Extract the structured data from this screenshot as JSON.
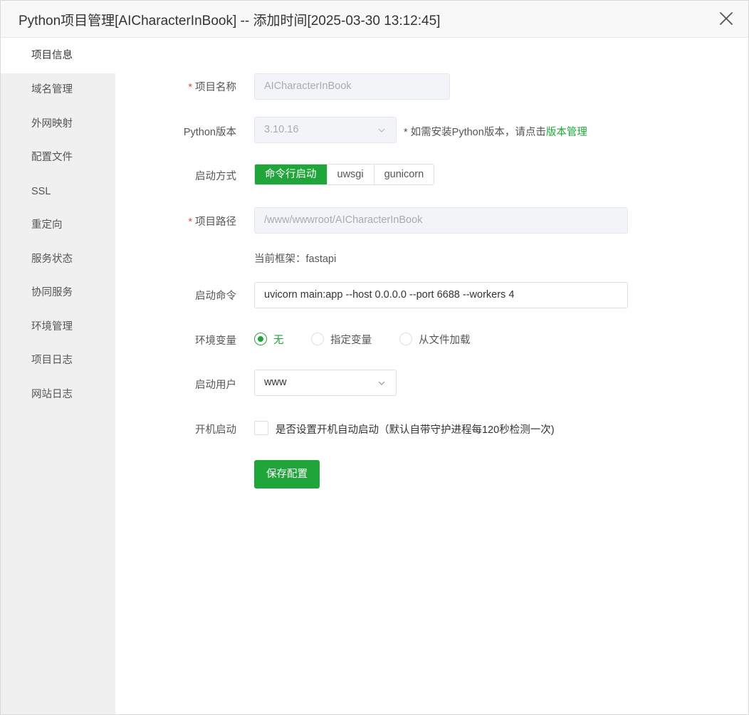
{
  "dialog": {
    "title": "Python项目管理[AICharacterInBook] -- 添加时间[2025-03-30 13:12:45]",
    "close_icon": "close-icon"
  },
  "sidebar": {
    "items": [
      {
        "label": "项目信息",
        "active": true
      },
      {
        "label": "域名管理"
      },
      {
        "label": "外网映射"
      },
      {
        "label": "配置文件"
      },
      {
        "label": "SSL"
      },
      {
        "label": "重定向"
      },
      {
        "label": "服务状态"
      },
      {
        "label": "协同服务"
      },
      {
        "label": "环境管理"
      },
      {
        "label": "项目日志"
      },
      {
        "label": "网站日志"
      }
    ]
  },
  "form": {
    "required_mark": "*",
    "project_name": {
      "label": "项目名称",
      "value": "AICharacterInBook"
    },
    "python_version": {
      "label": "Python版本",
      "value": "3.10.16",
      "hint_prefix": "* 如需安装Python版本，请点击",
      "hint_link": "版本管理"
    },
    "start_mode": {
      "label": "启动方式",
      "options": [
        "命令行启动",
        "uwsgi",
        "gunicorn"
      ],
      "selected": "命令行启动"
    },
    "project_path": {
      "label": "项目路径",
      "value": "/www/wwwroot/AICharacterInBook"
    },
    "framework": {
      "text": "当前框架：fastapi"
    },
    "start_command": {
      "label": "启动命令",
      "value": "uvicorn main:app --host 0.0.0.0 --port 6688 --workers 4"
    },
    "env_vars": {
      "label": "环境变量",
      "options": [
        "无",
        "指定变量",
        "从文件加载"
      ],
      "selected": "无"
    },
    "start_user": {
      "label": "启动用户",
      "value": "www"
    },
    "autostart": {
      "label": "开机启动",
      "checkbox_label": "是否设置开机自动启动（默认自带守护进程每120秒检测一次)",
      "checked": false
    },
    "save_label": "保存配置"
  },
  "colors": {
    "accent": "#20a53a",
    "required": "#e04a3b",
    "sidebar_bg": "#f0f0f0"
  }
}
